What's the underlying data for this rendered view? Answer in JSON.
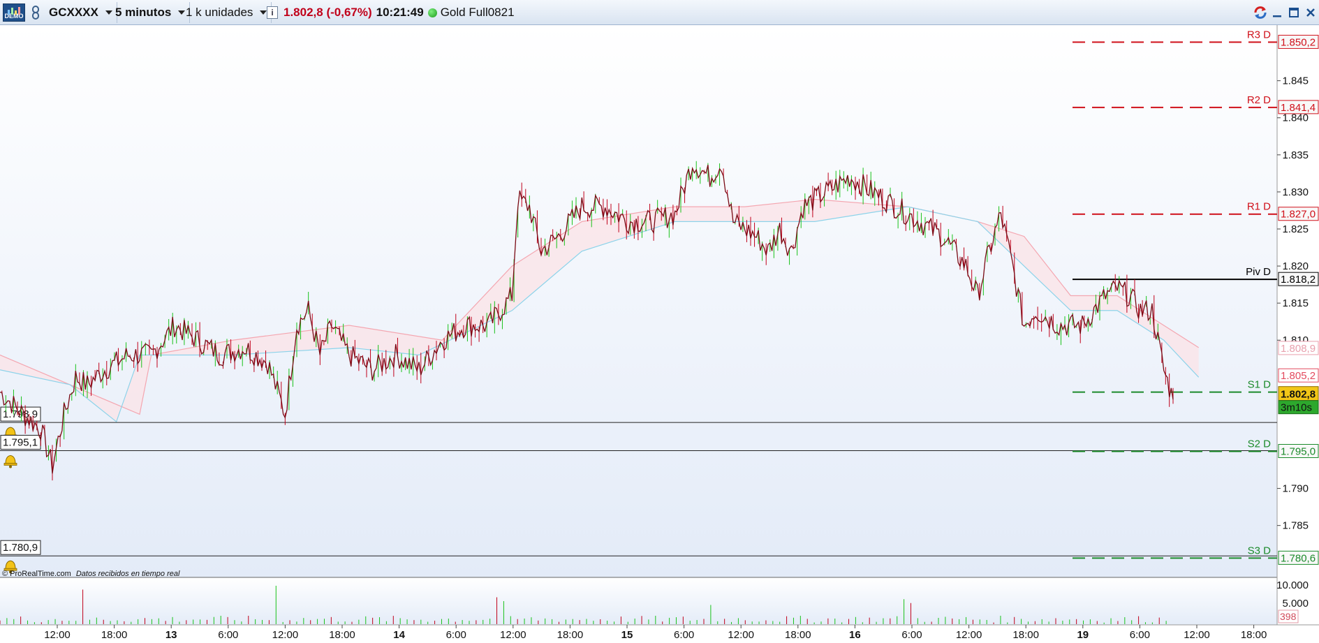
{
  "toolbar": {
    "demo_label": "DEMO",
    "symbol": "GCXXXX",
    "timeframe": "5 minutos",
    "units": "1 k unidades",
    "info_label": "i",
    "last_price": "1.802,8 (-0,67%)",
    "time": "10:21:49",
    "instrument": "Gold Full0821"
  },
  "window_controls": [
    "refresh-icon",
    "minimize-icon",
    "maximize-icon",
    "close-icon"
  ],
  "footer": {
    "copyright": "© ProRealTime.com",
    "realtime_note": "Datos recibidos en tiempo real"
  },
  "colors": {
    "chart_bg_top": "#ffffff",
    "chart_bg_bottom": "#e3ebf8",
    "candle_up": "#19c21a",
    "candle_down": "#c0001a",
    "price_line": "#7a0a14",
    "kumo_red": "#f4a6b0",
    "kumo_blue": "#8cd3ea",
    "resistance": "#d0101a",
    "support": "#1b8a2a",
    "pivot": "#000000"
  },
  "chart_data": {
    "type": "line",
    "price_axis": {
      "ticks": [
        "1.845",
        "1.840",
        "1.835",
        "1.830",
        "1.825",
        "1.820",
        "1.815",
        "1.810",
        "1.790",
        "1.785"
      ],
      "range": [
        1778.0,
        1852.5
      ]
    },
    "time_axis": {
      "ticks": [
        "12:00",
        "18:00",
        "13",
        "6:00",
        "12:00",
        "18:00",
        "14",
        "6:00",
        "12:00",
        "18:00",
        "15",
        "6:00",
        "12:00",
        "18:00",
        "16",
        "6:00",
        "12:00",
        "18:00",
        "19",
        "6:00",
        "12:00",
        "18:00"
      ],
      "bold_ticks": [
        "13",
        "14",
        "15",
        "16",
        "19"
      ]
    },
    "pivot_levels": [
      {
        "label": "R3 D",
        "value": 1850.2,
        "tag": "1.850,2",
        "kind": "resistance"
      },
      {
        "label": "R2 D",
        "value": 1841.4,
        "tag": "1.841,4",
        "kind": "resistance"
      },
      {
        "label": "R1 D",
        "value": 1827.0,
        "tag": "1.827,0",
        "kind": "resistance"
      },
      {
        "label": "Piv D",
        "value": 1818.2,
        "tag": "1.818,2",
        "kind": "pivot"
      },
      {
        "label": "S1 D",
        "value": 1803.0,
        "tag": "",
        "kind": "support"
      },
      {
        "label": "S2 D",
        "value": 1795.0,
        "tag": "1.795,0",
        "kind": "support"
      },
      {
        "label": "S3 D",
        "value": 1780.6,
        "tag": "1.780,6",
        "kind": "support"
      }
    ],
    "horizontal_lines": [
      {
        "value": 1798.9,
        "label": "1.798,9"
      },
      {
        "value": 1795.1,
        "label": "1.795,1"
      },
      {
        "value": 1780.9,
        "label": "1.780,9"
      }
    ],
    "indicator_tags": [
      {
        "label": "1.808,9",
        "value": 1808.9
      },
      {
        "label": "1.805,2",
        "value": 1805.2
      }
    ],
    "current_price": {
      "label": "1.802,8",
      "value": 1802.8,
      "countdown": "3m10s"
    },
    "price_series": [
      [
        0,
        1803
      ],
      [
        2,
        1800
      ],
      [
        3.5,
        1798
      ],
      [
        4.5,
        1793
      ],
      [
        5.5,
        1800
      ],
      [
        6.5,
        1805
      ],
      [
        7.5,
        1804
      ],
      [
        9,
        1806
      ],
      [
        11,
        1808
      ],
      [
        13,
        1808
      ],
      [
        15,
        1812
      ],
      [
        17,
        1810
      ],
      [
        19,
        1808
      ],
      [
        21,
        1809
      ],
      [
        23,
        1807
      ],
      [
        24.5,
        1800
      ],
      [
        25.5,
        1812
      ],
      [
        26.5,
        1814
      ],
      [
        27.5,
        1808
      ],
      [
        28.5,
        1812
      ],
      [
        30,
        1808
      ],
      [
        32,
        1806
      ],
      [
        34,
        1808
      ],
      [
        36,
        1806
      ],
      [
        38,
        1810
      ],
      [
        40,
        1812
      ],
      [
        42,
        1812
      ],
      [
        44,
        1816
      ],
      [
        44.5,
        1829
      ],
      [
        45.5,
        1828
      ],
      [
        46.5,
        1822
      ],
      [
        48,
        1824
      ],
      [
        50,
        1828
      ],
      [
        52,
        1828
      ],
      [
        54,
        1826
      ],
      [
        56,
        1826
      ],
      [
        58,
        1827
      ],
      [
        59.5,
        1834
      ],
      [
        61,
        1832
      ],
      [
        62,
        1834
      ],
      [
        63,
        1826
      ],
      [
        65,
        1824
      ],
      [
        66,
        1822
      ],
      [
        67,
        1825
      ],
      [
        68,
        1822
      ],
      [
        69,
        1828
      ],
      [
        71,
        1830
      ],
      [
        73,
        1832
      ],
      [
        75,
        1830
      ],
      [
        77,
        1828
      ],
      [
        79,
        1826
      ],
      [
        81,
        1824
      ],
      [
        83,
        1820
      ],
      [
        84,
        1816
      ],
      [
        85,
        1822
      ],
      [
        86,
        1827
      ],
      [
        87,
        1820
      ],
      [
        88,
        1812
      ],
      [
        89,
        1814
      ],
      [
        91,
        1812
      ],
      [
        93,
        1812
      ],
      [
        95,
        1816
      ],
      [
        96,
        1817
      ],
      [
        97,
        1816
      ],
      [
        98,
        1814
      ],
      [
        99,
        1814
      ],
      [
        100,
        1806
      ],
      [
        100.8,
        1802
      ]
    ],
    "span_red": [
      [
        0,
        1808
      ],
      [
        6,
        1804
      ],
      [
        12,
        1800
      ],
      [
        13,
        1808
      ],
      [
        20,
        1810
      ],
      [
        30,
        1812
      ],
      [
        38,
        1810
      ],
      [
        44,
        1820
      ],
      [
        50,
        1826
      ],
      [
        58,
        1828
      ],
      [
        64,
        1828
      ],
      [
        70,
        1829
      ],
      [
        78,
        1828
      ],
      [
        84,
        1826
      ],
      [
        88,
        1824
      ],
      [
        92,
        1816
      ],
      [
        96,
        1816
      ],
      [
        100,
        1812
      ],
      [
        103,
        1809
      ]
    ],
    "span_blue": [
      [
        0,
        1806
      ],
      [
        6,
        1804
      ],
      [
        10,
        1799
      ],
      [
        12,
        1808
      ],
      [
        20,
        1808
      ],
      [
        30,
        1809
      ],
      [
        36,
        1808
      ],
      [
        44,
        1814
      ],
      [
        50,
        1822
      ],
      [
        58,
        1826
      ],
      [
        64,
        1826
      ],
      [
        70,
        1826
      ],
      [
        78,
        1828
      ],
      [
        84,
        1826
      ],
      [
        88,
        1820
      ],
      [
        92,
        1814
      ],
      [
        96,
        1814
      ],
      [
        100,
        1810
      ],
      [
        103,
        1805
      ]
    ],
    "volume_axis": {
      "ticks": [
        "10.000",
        "5.000"
      ],
      "current": "398"
    }
  }
}
